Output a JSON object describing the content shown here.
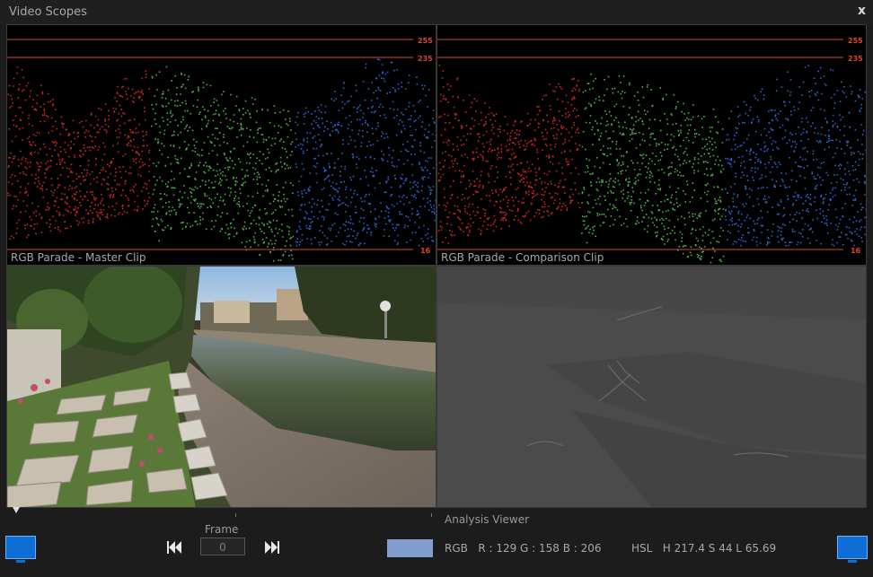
{
  "window": {
    "title": "Video Scopes",
    "close_label": "x"
  },
  "scopes": {
    "master_label": "RGB Parade - Master Clip",
    "comparison_label": "RGB Parade - Comparison Clip",
    "levels": [
      "255",
      "235",
      "16"
    ],
    "channel_colors": {
      "red": "#e02a1f",
      "green": "#53c250",
      "blue": "#2f6ee0"
    },
    "guide_color": "#d9472e"
  },
  "viewer": {
    "frame_label": "Frame",
    "frame_value": "0",
    "analysis_title": "Analysis Viewer",
    "swatch_color": "#819ece",
    "rgb_readout": "RGB   R : 129 G : 158 B : 206",
    "hsl_readout": "HSL   H 217.4 S 44 L 65.69"
  },
  "icons": {
    "rewind": "rewind-icon",
    "forward": "fast-forward-icon",
    "monitor": "monitor-icon"
  }
}
